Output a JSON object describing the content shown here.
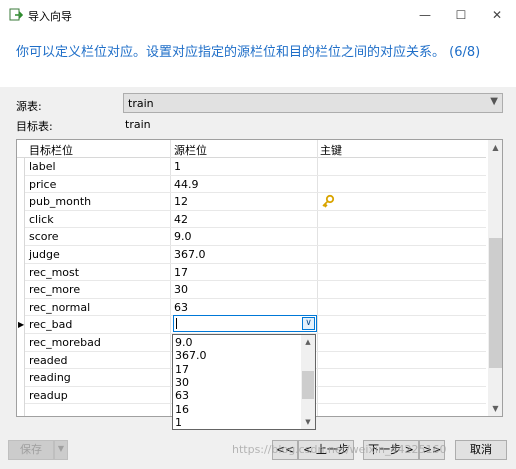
{
  "window": {
    "title": "导入向导",
    "minimize_glyph": "—",
    "maximize_glyph": "☐",
    "close_glyph": "✕"
  },
  "header": {
    "instruction": "你可以定义栏位对应。设置对应指定的源栏位和目的栏位之间的对应关系。 (6/8)"
  },
  "source_table": {
    "label": "源表:",
    "value": "train"
  },
  "target_table": {
    "label": "目标表:",
    "value": "train"
  },
  "grid": {
    "columns": [
      "目标栏位",
      "源栏位",
      "主键"
    ],
    "rows": [
      {
        "target": "label",
        "source": "1",
        "key": false
      },
      {
        "target": "price",
        "source": "44.9",
        "key": false
      },
      {
        "target": "pub_month",
        "source": "12",
        "key": true
      },
      {
        "target": "click",
        "source": "42",
        "key": false
      },
      {
        "target": "score",
        "source": "9.0",
        "key": false
      },
      {
        "target": "judge",
        "source": "367.0",
        "key": false
      },
      {
        "target": "rec_most",
        "source": "17",
        "key": false
      },
      {
        "target": "rec_more",
        "source": "30",
        "key": false
      },
      {
        "target": "rec_normal",
        "source": "63",
        "key": false
      },
      {
        "target": "rec_bad",
        "source": "",
        "key": false,
        "editing": true
      },
      {
        "target": "rec_morebad",
        "source": "",
        "key": false
      },
      {
        "target": "readed",
        "source": "",
        "key": false
      },
      {
        "target": "reading",
        "source": "",
        "key": false
      },
      {
        "target": "readup",
        "source": "",
        "key": false
      }
    ],
    "current_row_marker": "▶"
  },
  "dropdown": {
    "options": [
      "9.0",
      "367.0",
      "17",
      "30",
      "63",
      "16",
      "1"
    ]
  },
  "buttons": {
    "save": "保存",
    "first": "<<",
    "prev": "< 上一步",
    "next": "下一步 >",
    "last": ">>",
    "cancel": "取消"
  },
  "watermark": "https://blog.csdn.net/weixin_44225160",
  "colors": {
    "accent": "#1e6ec8",
    "key_icon": "#d9a400"
  }
}
